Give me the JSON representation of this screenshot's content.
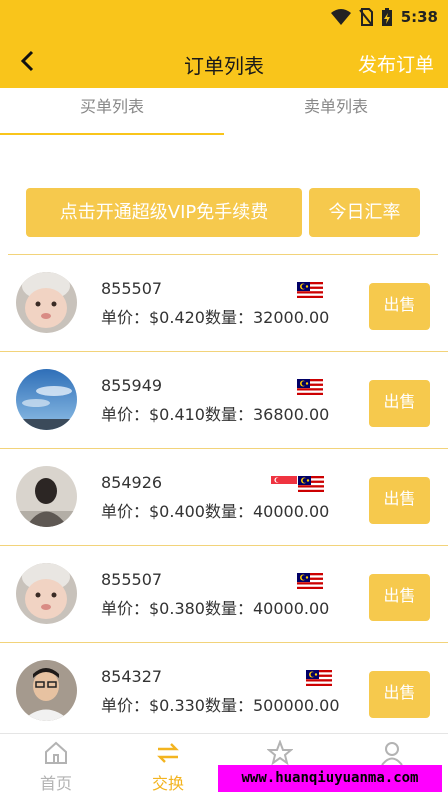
{
  "status_bar": {
    "time": "5:38",
    "icons": [
      "wifi-icon",
      "no-sim-icon",
      "battery-charging-icon"
    ]
  },
  "header": {
    "title": "订单列表",
    "back_icon": "back-chevron-icon",
    "publish_label": "发布订单"
  },
  "tabs": [
    {
      "label": "买单列表",
      "active": true
    },
    {
      "label": "卖单列表",
      "active": false
    }
  ],
  "actions": {
    "vip_label": "点击开通超级VIP免手续费",
    "rate_label": "今日汇率"
  },
  "colors": {
    "accent": "#f9c51b",
    "button": "#f6c94d",
    "divider": "#f2d37a",
    "nav_active": "#f3b41f"
  },
  "orders": [
    {
      "id": "855507",
      "price_line": "单价：$0.420数量：32000.00",
      "flags": [
        "malaysia-flag"
      ],
      "avatar": "baby-avatar",
      "action": "出售"
    },
    {
      "id": "855949",
      "price_line": "单价：$0.410数量：36800.00",
      "flags": [
        "malaysia-flag"
      ],
      "avatar": "sky-avatar",
      "action": "出售"
    },
    {
      "id": "854926",
      "price_line": "单价：$0.400数量：40000.00",
      "flags": [
        "singapore-flag",
        "malaysia-flag"
      ],
      "avatar": "silhouette-avatar",
      "action": "出售"
    },
    {
      "id": "855507",
      "price_line": "单价：$0.380数量：40000.00",
      "flags": [
        "malaysia-flag"
      ],
      "avatar": "baby-avatar",
      "action": "出售"
    },
    {
      "id": "854327",
      "price_line": "单价：$0.330数量：500000.00",
      "flags": [
        "malaysia-flag"
      ],
      "avatar": "man-avatar",
      "action": "出售"
    }
  ],
  "bottom_nav": [
    {
      "label": "首页",
      "icon": "home-icon",
      "active": false
    },
    {
      "label": "交换",
      "icon": "exchange-icon",
      "active": true
    },
    {
      "label": "",
      "icon": "star-icon",
      "active": false
    },
    {
      "label": "",
      "icon": "user-icon",
      "active": false
    }
  ],
  "watermark": "www.huanqiuyuanma.com"
}
